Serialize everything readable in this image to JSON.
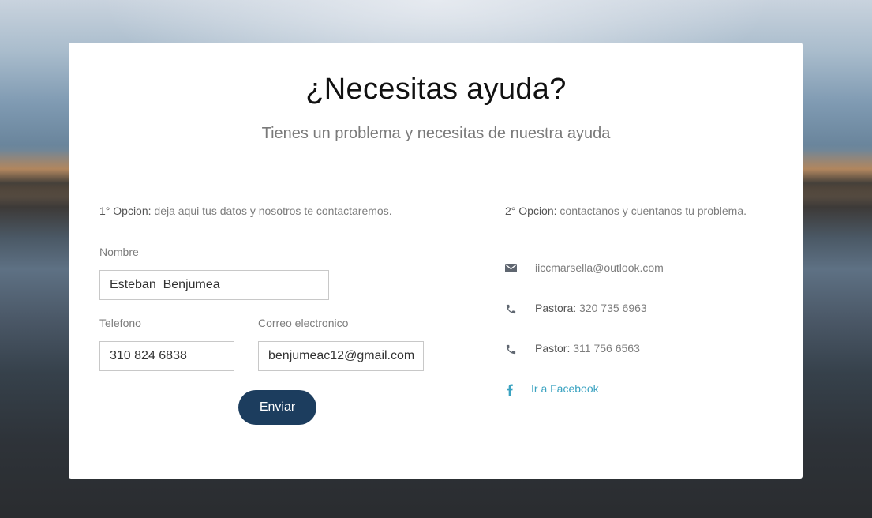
{
  "header": {
    "title": "¿Necesitas ayuda?",
    "subtitle": "Tienes un problema y necesitas de nuestra ayuda"
  },
  "option1": {
    "label": "1° Opcion:",
    "text": " deja aqui tus datos y nosotros te contactaremos."
  },
  "option2": {
    "label": "2° Opcion:",
    "text": " contactanos y cuentanos tu problema."
  },
  "form": {
    "name_label": "Nombre",
    "name_value": "Esteban  Benjumea",
    "phone_label": "Telefono",
    "phone_value": "310 824 6838",
    "email_label": "Correo electronico",
    "email_value": "benjumeac12@gmail.com",
    "submit_label": "Enviar"
  },
  "contacts": {
    "email": {
      "icon": "envelope-icon",
      "value": "iiccmarsella@outlook.com"
    },
    "pastora": {
      "icon": "phone-icon",
      "label": "Pastora:",
      "value": " 320 735 6963"
    },
    "pastor": {
      "icon": "phone-icon",
      "label": "Pastor:",
      "value": " 311 756 6563"
    },
    "facebook": {
      "icon": "facebook-icon",
      "link_text": "Ir a Facebook"
    }
  },
  "colors": {
    "button": "#1c3d5e",
    "link": "#3ba3c1",
    "icon": "#5f6670"
  }
}
